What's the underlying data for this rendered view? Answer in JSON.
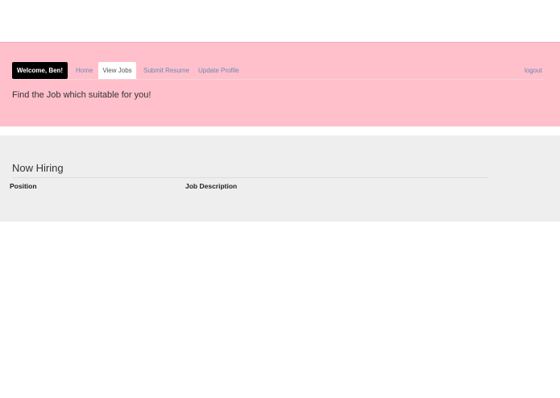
{
  "nav": {
    "brand": "Welcome, Ben!",
    "items": [
      {
        "label": "Home",
        "active": false
      },
      {
        "label": "View Jobs",
        "active": true
      },
      {
        "label": "Submit Resume",
        "active": false
      },
      {
        "label": "Update Profile",
        "active": false
      }
    ],
    "logout": "logout"
  },
  "header": {
    "tagline": "Find the Job which suitable for you!"
  },
  "hiring": {
    "title": "Now Hiring",
    "columns": [
      "Position",
      "Job Description"
    ]
  },
  "colors": {
    "header_background": "#ffc0cb",
    "brand_background": "#000000",
    "link": "#6f86b6",
    "section_background": "#eeeeee"
  }
}
